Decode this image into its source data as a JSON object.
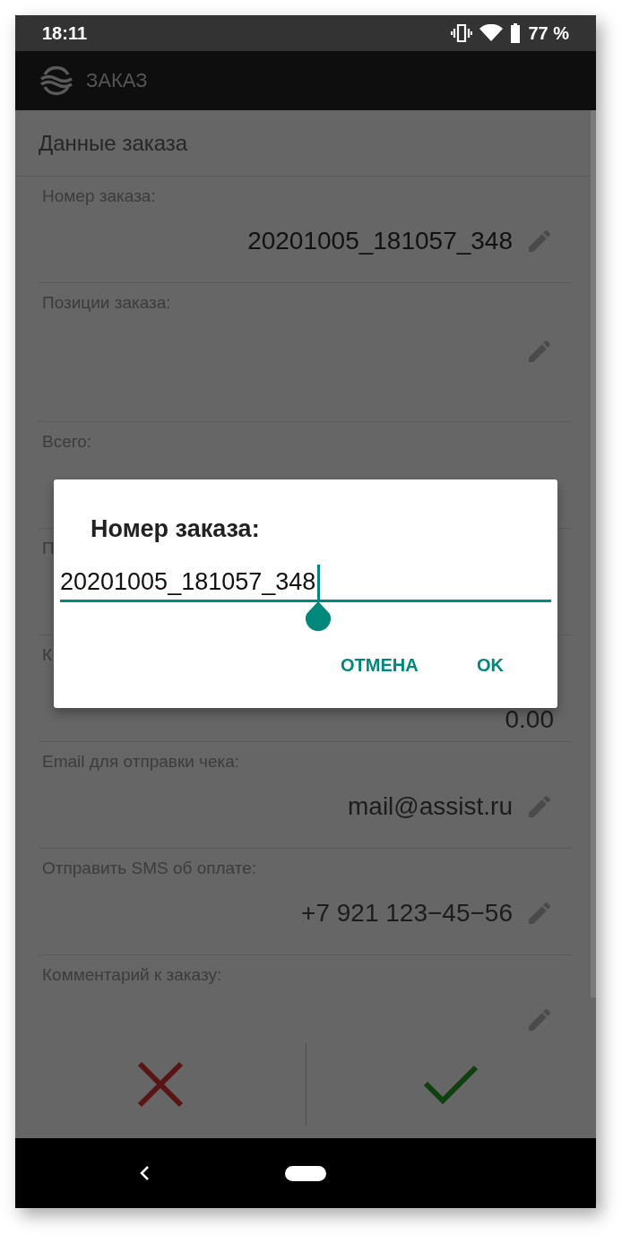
{
  "status_bar": {
    "time": "18:11",
    "battery": "77 %"
  },
  "app_bar": {
    "title": "ЗАКАЗ"
  },
  "section": {
    "title": "Данные заказа"
  },
  "fields": [
    {
      "label": "Номер заказа:",
      "value": "20201005_181057_348",
      "edit_icon": true
    },
    {
      "label": "Позиции заказа:",
      "edit_icon": true
    },
    {
      "label": "Всего:"
    },
    {
      "label": "П"
    },
    {
      "label": "К",
      "value": "0.00"
    },
    {
      "label": "Email для отправки чека:",
      "value": "mail@assist.ru",
      "edit_icon": true
    },
    {
      "label": "Отправить SMS об оплате:",
      "value": "+7 921 123−45−56",
      "edit_icon": true
    },
    {
      "label": "Комментарий к заказу:",
      "edit_icon": true
    }
  ],
  "dialog": {
    "title": "Номер заказа:",
    "value": "20201005_181057_348",
    "buttons": [
      "ОТМЕНА",
      "OK"
    ]
  }
}
